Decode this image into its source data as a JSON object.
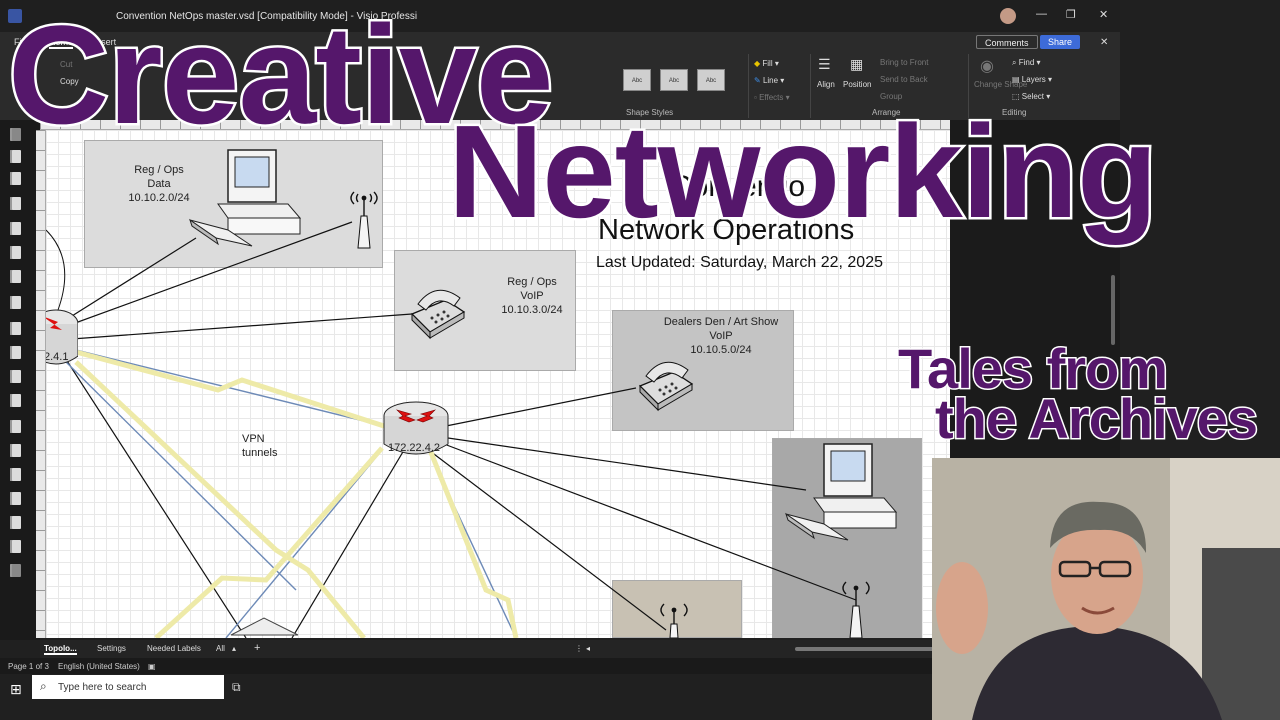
{
  "window": {
    "title": "Convention NetOps master.vsd  [Compatibility Mode]  -  Visio Professi",
    "minimize": "—",
    "maximize": "❐",
    "close": "✕"
  },
  "ribbon": {
    "tabs": [
      "File",
      "Home",
      "Insert"
    ],
    "active_tab": "Home",
    "cut": "Cut",
    "copy": "Copy",
    "comments": "Comments",
    "share": "Share",
    "close_pane": "✕",
    "fill": "Fill",
    "line": "Line",
    "effects": "Effects",
    "align": "Align",
    "position": "Position",
    "bring_to_front": "Bring to Front",
    "send_to_back": "Send to Back",
    "group": "Group",
    "change_shape": "Change Shape",
    "find": "Find",
    "layers": "Layers",
    "select": "Select",
    "style_sample": "Abc",
    "group_shape_styles": "Shape Styles",
    "group_arrange": "Arrange",
    "group_editing": "Editing"
  },
  "diagram": {
    "zones": [
      {
        "label": "Reg / Ops\nData\n10.10.2.0/24"
      },
      {
        "label": "Reg / Ops\nVoIP\n10.10.3.0/24"
      },
      {
        "label": "Dealers Den / Art Show\nVoIP\n10.10.5.0/24"
      }
    ],
    "router_left_label": "2.4.1",
    "router_center_label": "172.22.4.2",
    "vpn_label": "VPN\ntunnels",
    "heading_partial": "Conventio",
    "heading": "Network Operations",
    "last_updated": "Last Updated: Saturday, March 22, 2025"
  },
  "page_tabs": {
    "tabs": [
      "Topolo...",
      "Settings",
      "Needed Labels",
      "All"
    ],
    "add": "+"
  },
  "status": {
    "page": "Page 1 of 3",
    "language": "English (United States)"
  },
  "taskbar": {
    "search_placeholder": "Type here to search"
  },
  "overlay": {
    "line1": "Creative",
    "line2": "Networking",
    "line3": "Tales from",
    "line4": "the Archives"
  }
}
